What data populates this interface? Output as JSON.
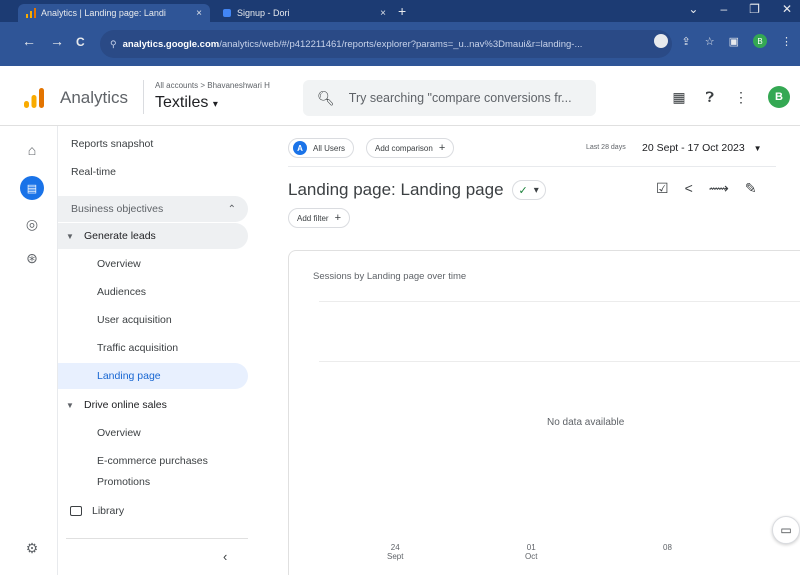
{
  "browser": {
    "tabs": [
      {
        "title": "Analytics | Landing page: Landi",
        "close": "×",
        "active": true
      },
      {
        "title": "Signup - Dori",
        "close": "×",
        "active": false
      }
    ],
    "new_tab": "+",
    "window_controls": [
      "⌄",
      "–",
      "❐",
      "✕"
    ],
    "nav": {
      "back": "←",
      "forward": "→",
      "reload": "C"
    },
    "url_host": "analytics.google.com",
    "url_path": "/analytics/web/#/p412211461/reports/explorer?params=_u..nav%3Dmaui&r=landing-...",
    "profile_initial": "B"
  },
  "header": {
    "product": "Analytics",
    "account_path": "All accounts > Bhavaneshwari H",
    "property": "Textiles",
    "property_caret": "▾",
    "search_placeholder": "Try searching \"compare conversions fr...",
    "avatar_initial": "B"
  },
  "nav": {
    "reports_snapshot": "Reports snapshot",
    "realtime": "Real-time",
    "section": "Business objectives",
    "generate_leads": "Generate leads",
    "generate_leads_items": [
      "Overview",
      "Audiences",
      "User acquisition",
      "Traffic acquisition",
      "Landing page"
    ],
    "drive_sales": "Drive online sales",
    "drive_sales_items": [
      "Overview",
      "E-commerce purchases",
      "Promotions"
    ],
    "library": "Library",
    "collapse": "‹"
  },
  "main": {
    "all_users_badge": "A",
    "all_users": "All Users",
    "add_comparison": "Add comparison",
    "date_label": "Last 28 days",
    "date_range": "20 Sept - 17 Oct 2023",
    "title": "Landing page: Landing page",
    "add_filter": "Add filter",
    "card_title": "Sessions by Landing page over time",
    "no_data": "No data available"
  },
  "chart_data": {
    "type": "line",
    "title": "Sessions by Landing page over time",
    "x_ticks": [
      {
        "day": "24",
        "month": "Sept"
      },
      {
        "day": "01",
        "month": "Oct"
      },
      {
        "day": "08",
        "month": ""
      }
    ],
    "series": [],
    "grid": true,
    "message": "No data available"
  },
  "colors": {
    "tabstrip": "#1c3b73",
    "toolbar": "#2f5597",
    "accent": "#1a73e8",
    "selected_bg": "#e8f0fe",
    "avatar": "#34a853"
  }
}
